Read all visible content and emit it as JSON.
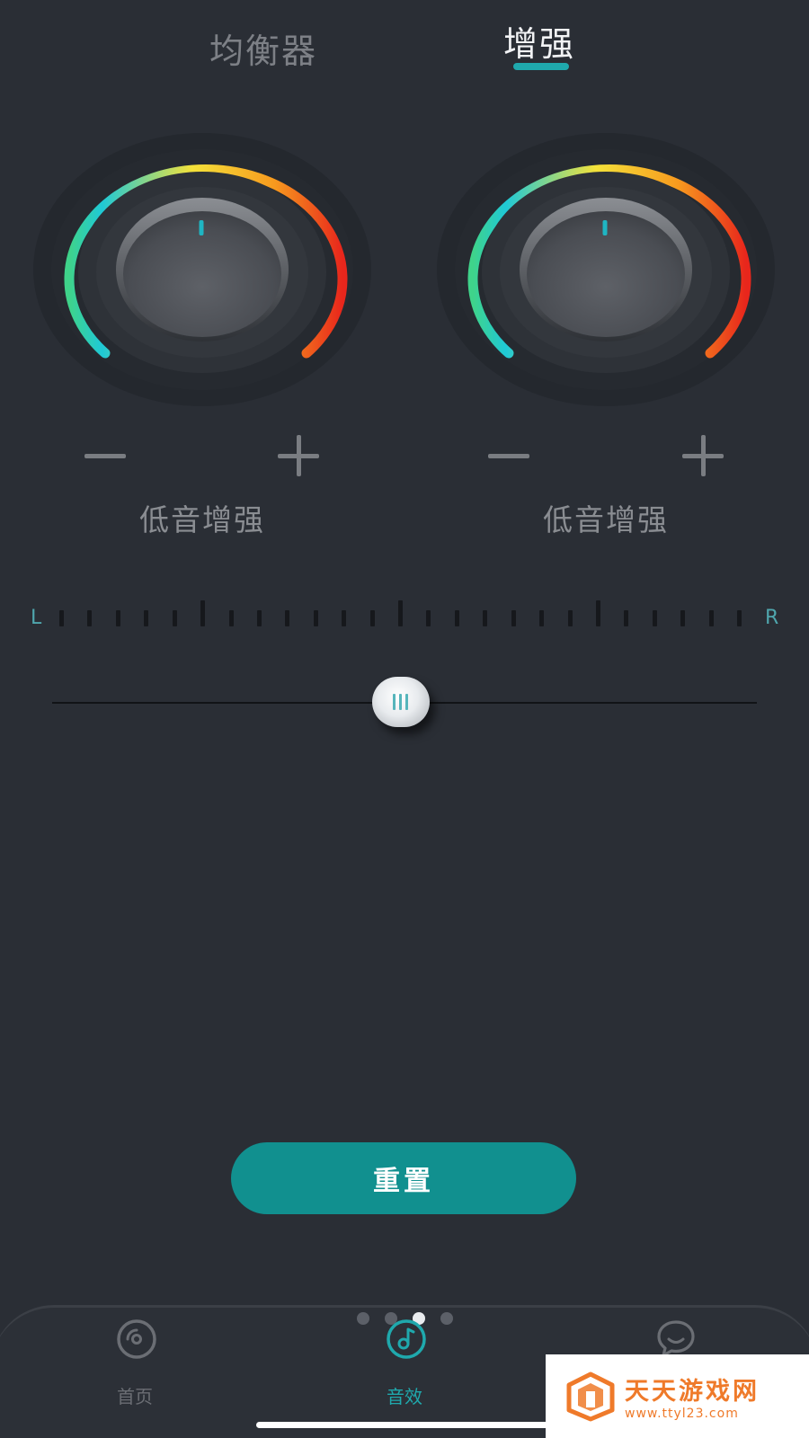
{
  "tabs": [
    {
      "label": "均衡器",
      "active": false
    },
    {
      "label": "增强",
      "active": true
    }
  ],
  "knobs": [
    {
      "label": "低音增强",
      "minus": "−",
      "plus": "+"
    },
    {
      "label": "低音增强",
      "minus": "−",
      "plus": "+"
    }
  ],
  "balance": {
    "left_label": "L",
    "right_label": "R",
    "value_fraction": 0.5
  },
  "reset_label": "重置",
  "page_indicator": {
    "count": 4,
    "active_index": 2
  },
  "nav": [
    {
      "label": "首页",
      "icon": "disc-icon",
      "active": false
    },
    {
      "label": "音效",
      "icon": "music-note-icon",
      "active": true
    },
    {
      "label": "",
      "icon": "chat-bubble-icon",
      "active": false
    }
  ],
  "watermark": {
    "title": "天天游戏网",
    "url": "www.ttyl23.com"
  },
  "colors": {
    "background": "#2a2e35",
    "accent": "#1fa9ad",
    "button": "#11908f",
    "watermark": "#ef7a2a"
  }
}
